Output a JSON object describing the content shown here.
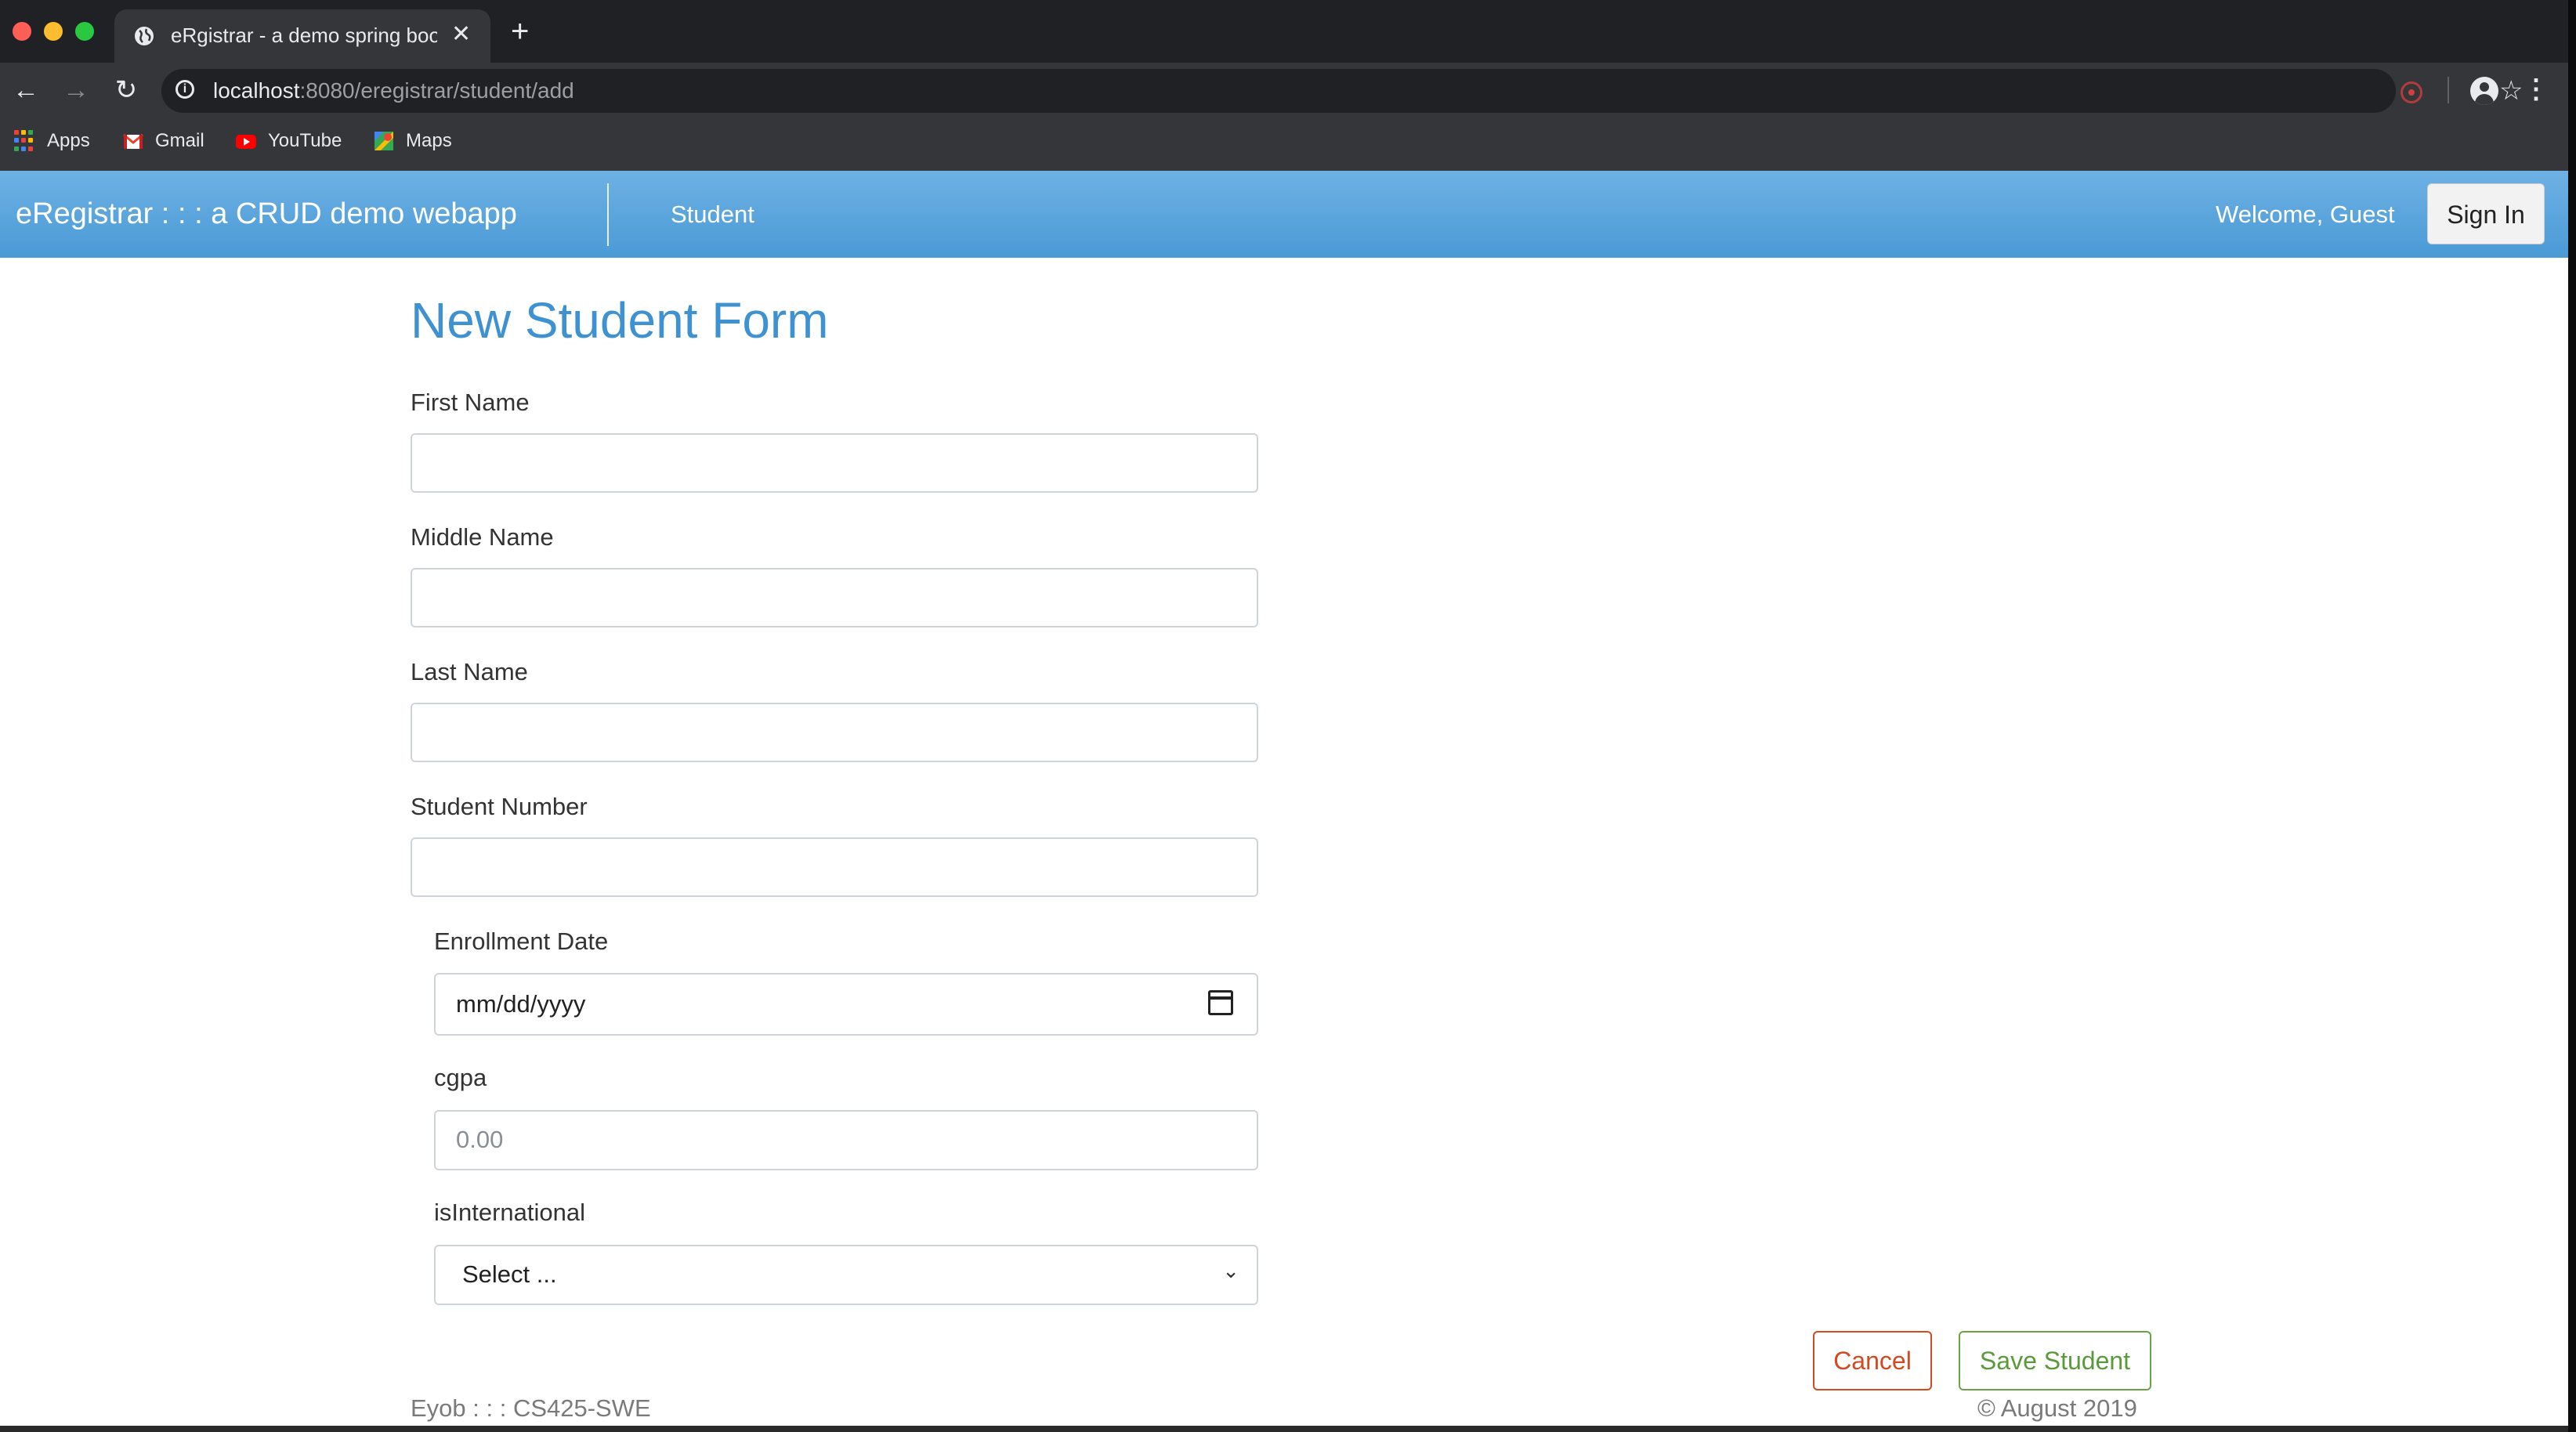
{
  "browser": {
    "tab_title": "eRgistrar - a demo spring boot",
    "url_host": "localhost",
    "url_path": ":8080/eregistrar/student/add",
    "new_tab_symbol": "+",
    "close_symbol": "✕",
    "bookmarks": [
      {
        "label": "Apps",
        "icon": "apps-grid-icon"
      },
      {
        "label": "Gmail",
        "icon": "gmail-icon"
      },
      {
        "label": "YouTube",
        "icon": "youtube-icon"
      },
      {
        "label": "Maps",
        "icon": "maps-icon"
      }
    ]
  },
  "navbar": {
    "brand": "eRegistrar : : : a CRUD demo webapp",
    "student_link": "Student",
    "welcome": "Welcome, Guest",
    "signin": "Sign In",
    "color": "#5aa6de"
  },
  "form": {
    "title": "New Student Form",
    "first_name_label": "First Name",
    "middle_name_label": "Middle Name",
    "last_name_label": "Last Name",
    "student_number_label": "Student Number",
    "enrollment_date_label": "Enrollment Date",
    "enrollment_date_placeholder": "mm/dd/yyyy",
    "cgpa_label": "cgpa",
    "cgpa_placeholder": "0.00",
    "international_label": "isInternational",
    "international_selected": "Select ...",
    "cancel": "Cancel",
    "save": "Save Student"
  },
  "footer": {
    "left": "Eyob : : : CS425-SWE",
    "right": "© August 2019"
  }
}
